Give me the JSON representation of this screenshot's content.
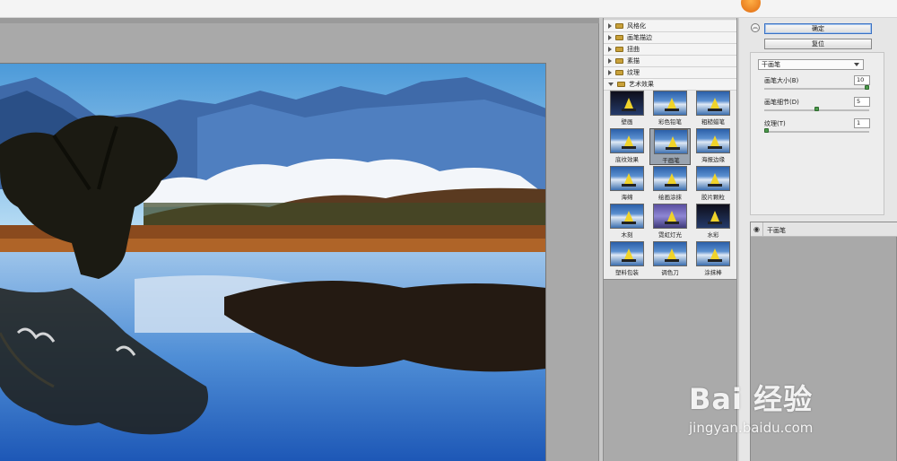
{
  "filter_gallery": {
    "folders": [
      {
        "label": "风格化",
        "open": false
      },
      {
        "label": "画笔描边",
        "open": false
      },
      {
        "label": "扭曲",
        "open": false
      },
      {
        "label": "素描",
        "open": false
      },
      {
        "label": "纹理",
        "open": false
      },
      {
        "label": "艺术效果",
        "open": true
      }
    ],
    "thumbnails": [
      {
        "label": "壁画"
      },
      {
        "label": "彩色铅笔"
      },
      {
        "label": "粗糙蜡笔"
      },
      {
        "label": "底纹效果"
      },
      {
        "label": "干画笔",
        "selected": true
      },
      {
        "label": "海报边缘"
      },
      {
        "label": "海绵"
      },
      {
        "label": "绘画涂抹"
      },
      {
        "label": "胶片颗粒"
      },
      {
        "label": "木刻"
      },
      {
        "label": "霓虹灯光"
      },
      {
        "label": "水彩"
      },
      {
        "label": "塑料包装"
      },
      {
        "label": "调色刀"
      },
      {
        "label": "涂抹棒"
      }
    ]
  },
  "settings": {
    "ok_label": "确定",
    "reset_label": "复位",
    "selected_filter": "干画笔",
    "params": [
      {
        "label": "画笔大小(B)",
        "value": "10",
        "fraction": 1.0
      },
      {
        "label": "画笔细节(D)",
        "value": "5",
        "fraction": 0.5
      },
      {
        "label": "纹理(T)",
        "value": "1",
        "fraction": 0.0
      }
    ]
  },
  "layers": {
    "items": [
      {
        "label": "干画笔"
      }
    ]
  },
  "watermark": {
    "brand": "Bai 经验",
    "url": "jingyan.baidu.com"
  },
  "icons": {
    "collapse": "double-chevron-up-icon",
    "eye": "eye-icon",
    "folder": "folder-icon"
  }
}
